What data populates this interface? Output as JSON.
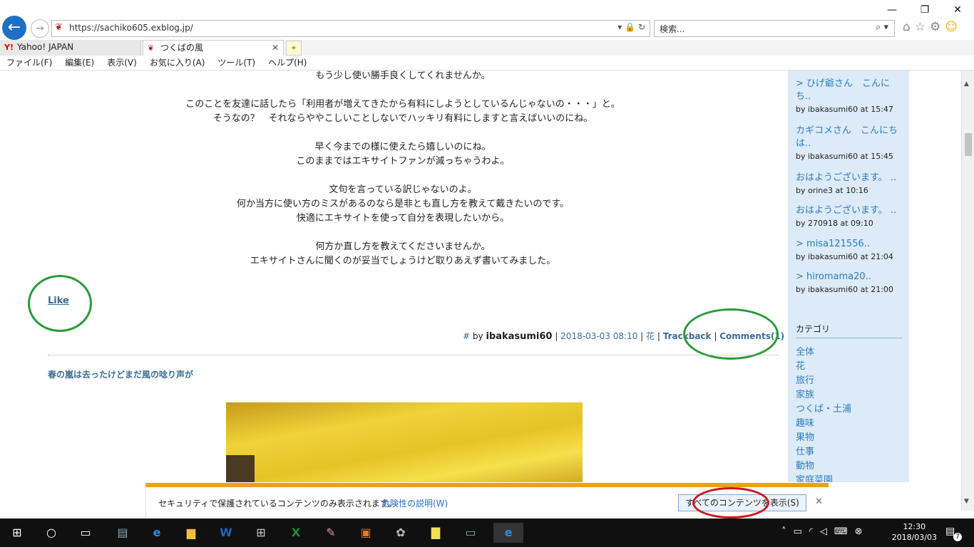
{
  "browser": {
    "url": "https://sachiko605.exblog.jp/",
    "search_placeholder": "検索...",
    "tabs": [
      {
        "label": "Yahoo! JAPAN",
        "icon": "yahoo-icon"
      },
      {
        "label": "つくばの風",
        "icon": "exblog-icon"
      }
    ],
    "menu": [
      "ファイル(F)",
      "編集(E)",
      "表示(V)",
      "お気に入り(A)",
      "ツール(T)",
      "ヘルプ(H)"
    ]
  },
  "post": {
    "lines": [
      "もう少し使い勝手良くしてくれませんか。",
      "このことを友達に話したら「利用者が増えてきたから有料にしようとしているんじゃないの・・・」と。",
      "そうなの？　それならややこしいことしないでハッキリ有料にしますと言えばいいのにね。",
      "早く今までの様に使えたら嬉しいのにね。",
      "このままではエキサイトファンが減っちゃうわよ。",
      "文句を言っている訳じゃないのよ。",
      "何か当方に使い方のミスがあるのなら是非とも直し方を教えて戴きたいのです。",
      "快適にエキサイトを使って自分を表現したいから。",
      "何方か直し方を教えてくださいませんか。",
      "エキサイトさんに聞くのが妥当でしょうけど取りあえず書いてみました。"
    ],
    "like": "Like",
    "meta": {
      "hash": "#",
      "by": "by",
      "author": "ibakasumi60",
      "datetime": "2018-03-03 08:10",
      "category": "花",
      "trackback": "Trackback",
      "comments": "Comments(1)",
      "sep": "|"
    },
    "next_title": "春の嵐は去ったけどまだ風の唸り声が"
  },
  "sidebar": {
    "comments": [
      {
        "title": "> ひげ爺さん　こんにち..",
        "by": "by ibakasumi60 at 15:47"
      },
      {
        "title": "カギコメさん　こんにちは..",
        "by": "by ibakasumi60 at 15:45"
      },
      {
        "title": "おはようございます。 ..",
        "by": "by orine3 at 10:16"
      },
      {
        "title": "おはようございます。 ..",
        "by": "by 270918 at 09:10"
      },
      {
        "title": "> misa121556..",
        "by": "by ibakasumi60 at 21:04"
      },
      {
        "title": "> hiromama20..",
        "by": "by ibakasumi60 at 21:00"
      }
    ],
    "category_heading": "カテゴリ",
    "categories": [
      "全体",
      "花",
      "旅行",
      "家族",
      "つくば・土浦",
      "趣味",
      "果物",
      "仕事",
      "動物",
      "家庭菜園"
    ]
  },
  "notification": {
    "text": "セキュリティで保護されているコンテンツのみ表示されます。",
    "link": "危険性の説明(W)",
    "button": "すべてのコンテンツを表示(S)"
  },
  "taskbar": {
    "time": "12:30",
    "date": "2018/03/03",
    "notifications_count": "7"
  },
  "colors": {
    "annotation_green": "#2a9a3a",
    "annotation_red": "#d0141a",
    "notification_accent": "#e8a315",
    "link": "#3b6f93"
  }
}
